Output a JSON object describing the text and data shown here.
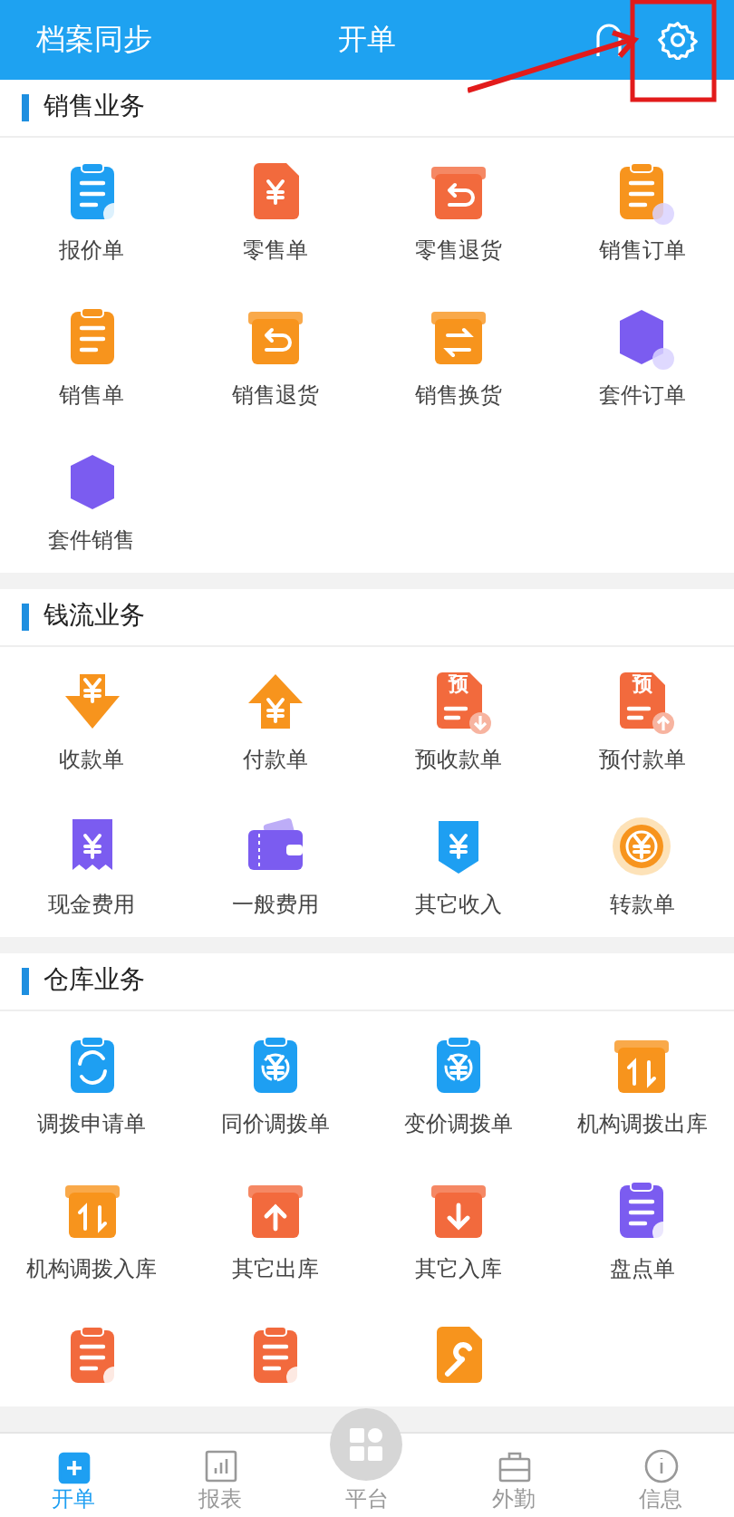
{
  "header": {
    "left": "档案同步",
    "title": "开单"
  },
  "sections": [
    {
      "title": "销售业务",
      "items": [
        {
          "label": "报价单"
        },
        {
          "label": "零售单"
        },
        {
          "label": "零售退货"
        },
        {
          "label": "销售订单"
        },
        {
          "label": "销售单"
        },
        {
          "label": "销售退货"
        },
        {
          "label": "销售换货"
        },
        {
          "label": "套件订单"
        },
        {
          "label": "套件销售"
        }
      ]
    },
    {
      "title": "钱流业务",
      "items": [
        {
          "label": "收款单"
        },
        {
          "label": "付款单"
        },
        {
          "label": "预收款单",
          "badge": "预"
        },
        {
          "label": "预付款单",
          "badge": "预"
        },
        {
          "label": "现金费用"
        },
        {
          "label": "一般费用"
        },
        {
          "label": "其它收入"
        },
        {
          "label": "转款单"
        }
      ]
    },
    {
      "title": "仓库业务",
      "items": [
        {
          "label": "调拨申请单"
        },
        {
          "label": "同价调拨单"
        },
        {
          "label": "变价调拨单"
        },
        {
          "label": "机构调拨出库"
        },
        {
          "label": "机构调拨入库"
        },
        {
          "label": "其它出库"
        },
        {
          "label": "其它入库"
        },
        {
          "label": "盘点单"
        },
        {
          "kind": "cut"
        },
        {
          "kind": "cut"
        },
        {
          "kind": "cut"
        }
      ]
    }
  ],
  "nav": [
    {
      "label": "开单",
      "selected": true
    },
    {
      "label": "报表",
      "selected": false
    },
    {
      "label": "平台",
      "selected": false
    },
    {
      "label": "外勤",
      "selected": false
    },
    {
      "label": "信息",
      "selected": false
    }
  ]
}
